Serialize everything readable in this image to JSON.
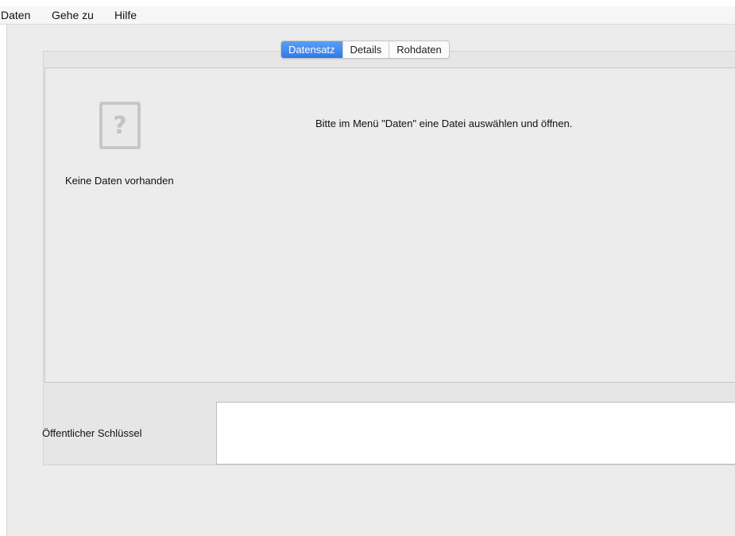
{
  "menubar": {
    "items": [
      {
        "label": "Daten"
      },
      {
        "label": "Gehe zu"
      },
      {
        "label": "Hilfe"
      }
    ]
  },
  "tabs": [
    {
      "label": "Datensatz",
      "active": true
    },
    {
      "label": "Details",
      "active": false
    },
    {
      "label": "Rohdaten",
      "active": false
    }
  ],
  "main": {
    "icon": "question-mark-icon",
    "no_data_label": "Keine Daten vorhanden",
    "hint": "Bitte im Menü \"Daten\" eine Datei auswählen und öffnen."
  },
  "public_key": {
    "label": "Öffentlicher Schlüssel",
    "value": ""
  },
  "colors": {
    "accent": "#2f79e8",
    "background": "#ececec"
  }
}
